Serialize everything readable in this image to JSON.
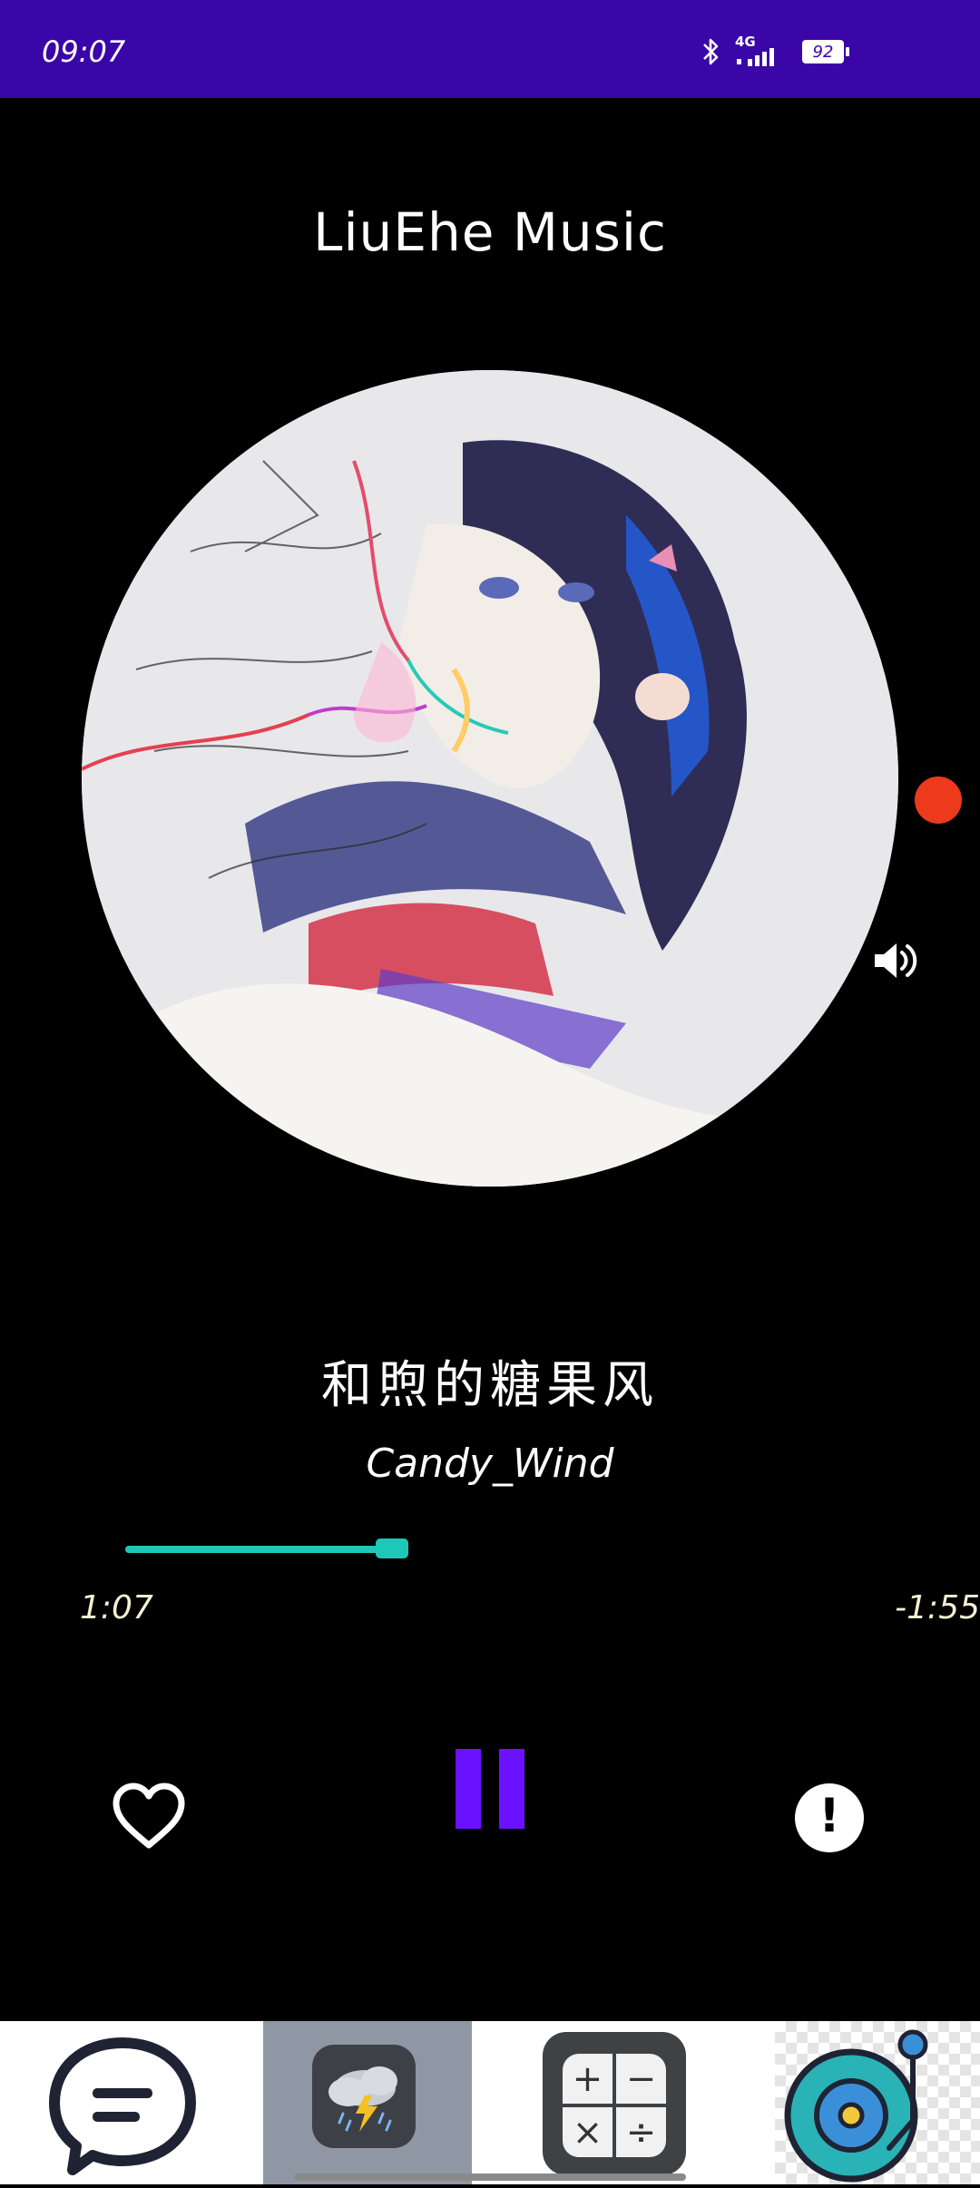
{
  "status_bar": {
    "time": "09:07",
    "network": "4G",
    "battery": "92",
    "background_color": "#3a06a8"
  },
  "app": {
    "title": "LiuEhe Music"
  },
  "now_playing": {
    "album_art": "anime-girl-illustration",
    "song_title": "和煦的糖果风",
    "artist": "Candy_Wind",
    "elapsed": "1:07",
    "remaining": "-1:55",
    "progress_fraction": 0.35,
    "accent_color": "#1ec7b8",
    "pause_color": "#6a12ff",
    "record_dot_color": "#ee3a1c"
  },
  "icons": {
    "volume": "volume-icon",
    "heart": "heart-icon",
    "info": "info-icon",
    "pause": "pause-icon",
    "info_glyph": "!"
  },
  "dock": {
    "items": [
      {
        "name": "chat-app",
        "icon": "chat-bubble-icon"
      },
      {
        "name": "weather-app",
        "icon": "storm-cloud-icon",
        "selected": true
      },
      {
        "name": "calculator-app",
        "icon": "calculator-icon",
        "keys": [
          "+",
          "−",
          "×",
          "÷"
        ]
      },
      {
        "name": "music-app",
        "icon": "vinyl-record-icon"
      }
    ]
  }
}
